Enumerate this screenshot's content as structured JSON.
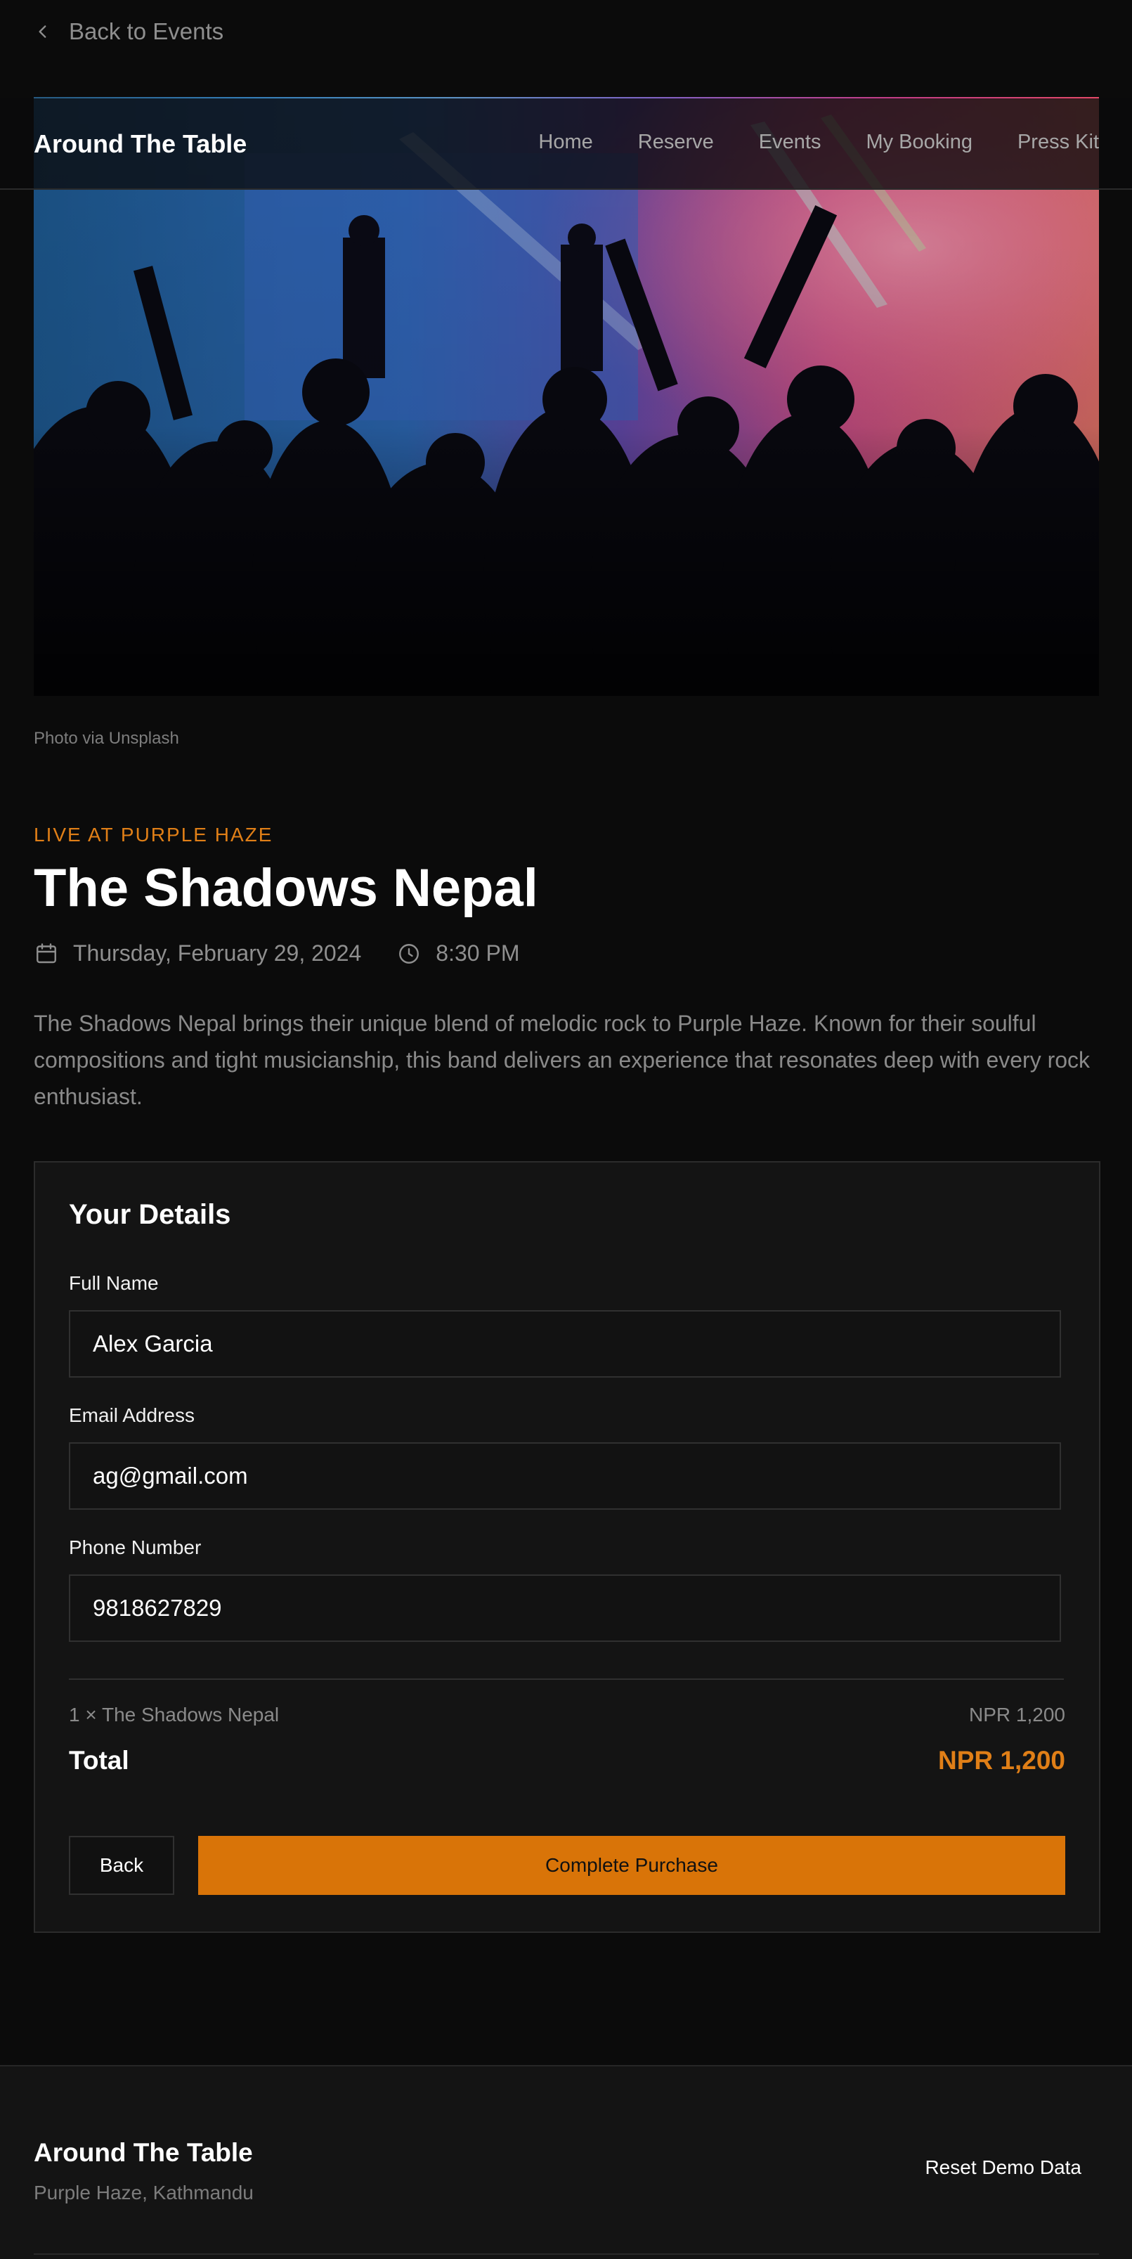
{
  "back_link": {
    "label": "Back to Events",
    "icon": "chevron-left-icon"
  },
  "header": {
    "brand": "Around The Table",
    "nav": [
      "Home",
      "Reserve",
      "Events",
      "My Booking",
      "Press Kit"
    ]
  },
  "hero": {
    "caption": "Photo via Unsplash"
  },
  "event": {
    "eyebrow": "LIVE AT PURPLE HAZE",
    "title": "The Shadows Nepal",
    "date": "Thursday, February 29, 2024",
    "time": "8:30 PM",
    "description": "The Shadows Nepal brings their unique blend of melodic rock to Purple Haze. Known for their soulful compositions and tight musicianship, this band delivers an experience that resonates deep with every rock enthusiast."
  },
  "form": {
    "heading": "Your Details",
    "full_name_label": "Full Name",
    "full_name_value": "Alex Garcia",
    "email_label": "Email Address",
    "email_value": "ag@gmail.com",
    "phone_label": "Phone Number",
    "phone_value": "9818627829"
  },
  "summary": {
    "line_item": "1 × The Shadows Nepal",
    "line_price": "NPR 1,200",
    "total_label": "Total",
    "total_value": "NPR 1,200"
  },
  "actions": {
    "back": "Back",
    "purchase": "Complete Purchase"
  },
  "footer": {
    "brand": "Around The Table",
    "location": "Purple Haze, Kathmandu",
    "reset": "Reset Demo Data"
  },
  "colors": {
    "accent": "#e07f17",
    "button": "#d97408",
    "background": "#0b0b0b"
  }
}
